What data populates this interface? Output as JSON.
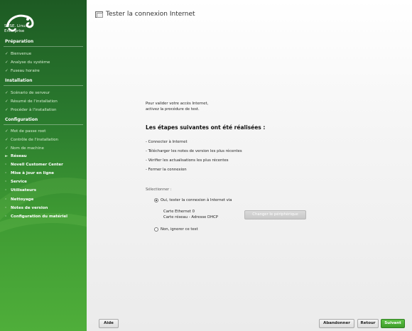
{
  "sidebar": {
    "logo_lines": [
      "SUSE. Linux",
      "Enterprise"
    ],
    "sections": [
      {
        "title": "Préparation"
      },
      {
        "title": "Installation"
      },
      {
        "title": "Configuration"
      }
    ],
    "preparation_steps": [
      "Bienvenue",
      "Analyse du système",
      "Fuseau horaire"
    ],
    "installation_steps": [
      "Scénario de serveur",
      "Résumé de l'installation",
      "Procéder à l'installation"
    ],
    "configuration_done": [
      "Mot de passe root",
      "Contrôle de l'installation",
      "Nom de machine"
    ],
    "current_step": "Réseau",
    "configuration_todo": [
      "Novell Customer Center",
      "Mise à jour en ligne",
      "Service",
      "Utilisateurs",
      "Nettoyage",
      "Notes de version",
      "Configuration du matériel"
    ],
    "icons": {
      "done": "check-icon",
      "current": "arrow-right-icon",
      "todo": "bullet-icon"
    }
  },
  "main": {
    "title": "Tester la connexion Internet",
    "intro_line1": "Pour valider votre accès Internet,",
    "intro_line2": "activez la procédure de test.",
    "heading": "Les étapes suivantes ont été réalisées :",
    "steps": [
      "- Connecter à Internet",
      "- Télécharger les notes de version les plus récentes",
      "- Vérifier les actualisations les plus récentes",
      "- Fermer la connexion"
    ],
    "select_label": "Sélectionner :",
    "option_yes": "Oui, tester la connexion à Internet via",
    "device_line1": "Carte Ethernet 0",
    "device_line2": "Carte réseau - Adresse DHCP",
    "change_device_button": "Changer le périphérique",
    "option_no": "Non, ignorer ce test",
    "selected_option": "yes"
  },
  "footer": {
    "help": "Aide",
    "abort": "Abandonner",
    "back": "Retour",
    "next": "Suivant"
  },
  "colors": {
    "sidebar_dark": "#1d5a23",
    "sidebar_light": "#4fae3a",
    "primary_button": "#4cae36"
  }
}
